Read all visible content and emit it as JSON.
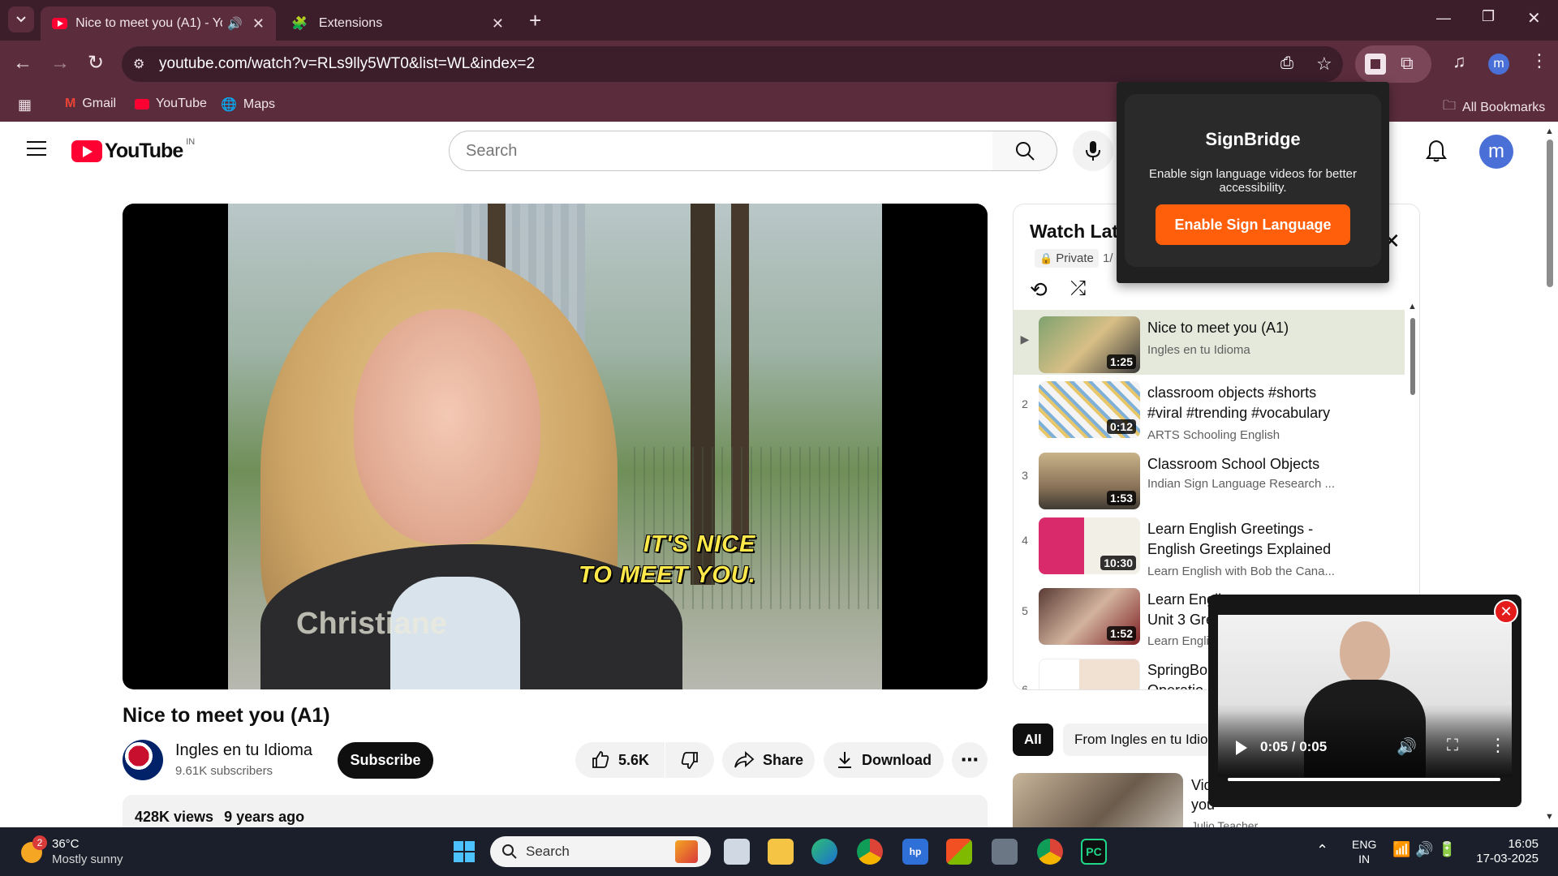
{
  "browser": {
    "tabs": [
      {
        "title": "Nice to meet you (A1) - You",
        "active": true
      },
      {
        "title": "Extensions",
        "active": false
      }
    ],
    "url": "youtube.com/watch?v=RLs9lly5WT0&list=WL&index=2",
    "bookmarks": [
      "Gmail",
      "YouTube",
      "Maps"
    ],
    "all_bookmarks": "All Bookmarks",
    "profile_initial": "m"
  },
  "youtube": {
    "logo_text": "YouTube",
    "region": "IN",
    "search_placeholder": "Search",
    "avatar_initial": "m",
    "video": {
      "caption_line1": "IT'S NICE",
      "caption_line2": "TO MEET YOU.",
      "name_overlay": "Christiane",
      "title": "Nice to meet you (A1)",
      "channel": "Ingles en tu Idioma",
      "subscribers": "9.61K subscribers",
      "subscribe_label": "Subscribe",
      "likes": "5.6K",
      "share_label": "Share",
      "download_label": "Download",
      "views": "428K views",
      "age": "9 years ago"
    },
    "playlist": {
      "title": "Watch Lat",
      "privacy": "Private",
      "position": "1/",
      "items": [
        {
          "index": "▶",
          "title": "Nice to meet you (A1)",
          "channel": "Ingles en tu Idioma",
          "duration": "1:25"
        },
        {
          "index": "2",
          "title": "classroom objects #shorts #viral #trending #vocabulary",
          "channel": "ARTS Schooling English",
          "duration": "0:12"
        },
        {
          "index": "3",
          "title": "Classroom School Objects",
          "channel": "Indian Sign Language Research ...",
          "duration": "1:53"
        },
        {
          "index": "4",
          "title": "Learn English Greetings - English Greetings Explained i...",
          "channel": "Learn English with Bob the Cana...",
          "duration": "10:30"
        },
        {
          "index": "5",
          "title": "Learn Engli",
          "title_line2": "Unit 3 Gre",
          "channel": "Learn Engli",
          "duration": "1:52"
        },
        {
          "index": "6",
          "title": "SpringBo",
          "title_line2": "Operatio",
          "channel": "",
          "duration": ""
        }
      ]
    },
    "chips": [
      "All",
      "From Ingles en tu Idio"
    ],
    "rec": {
      "title": "Vid",
      "title2": "you",
      "channel": "Julio Teacher"
    }
  },
  "signbridge": {
    "title": "SignBridge",
    "description": "Enable sign language videos for better accessibility.",
    "button": "Enable Sign Language"
  },
  "mini_player": {
    "time": "0:05 / 0:05",
    "progress": 1.0
  },
  "taskbar": {
    "weather_temp": "36°C",
    "weather_desc": "Mostly sunny",
    "weather_badge": "2",
    "search_label": "Search",
    "lang1": "ENG",
    "lang2": "IN",
    "time": "16:05",
    "date": "17-03-2025"
  }
}
